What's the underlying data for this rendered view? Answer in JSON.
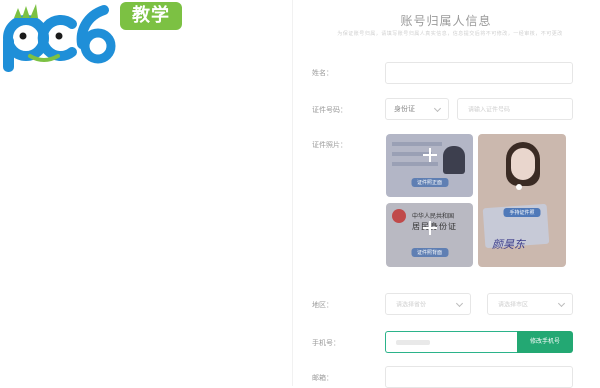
{
  "logo": {
    "text": "pc6",
    "badge": "教学"
  },
  "form": {
    "title": "账号归属人信息",
    "subtitle": "为保证账号归属，请填写账号归属人真实信息，信息提交后将不可修改，一经审核，不可更改"
  },
  "fields": {
    "name": {
      "label": "姓名：",
      "value": ""
    },
    "id_type": {
      "label": "证件号码：",
      "selected": "身份证"
    },
    "id_number": {
      "placeholder": "请输入证件号码"
    },
    "id_photos": {
      "label": "证件照片：",
      "front_button": "证件照正面",
      "back_button": "证件照背面",
      "handheld_button": "手持证件照"
    },
    "region": {
      "label": "地区：",
      "province_placeholder": "请选择省份",
      "city_placeholder": "请选择市区"
    },
    "phone": {
      "label": "手机号：",
      "button": "修改手机号"
    },
    "email": {
      "label": "邮箱："
    }
  },
  "id_card_text": {
    "back_line1": "中华人民共和国",
    "back_line2": "居民身份证"
  },
  "handwriting": "颜昊东",
  "colors": {
    "accent": "#23a873",
    "logo_blue": "#1f8fd8",
    "logo_green": "#7cc143"
  }
}
